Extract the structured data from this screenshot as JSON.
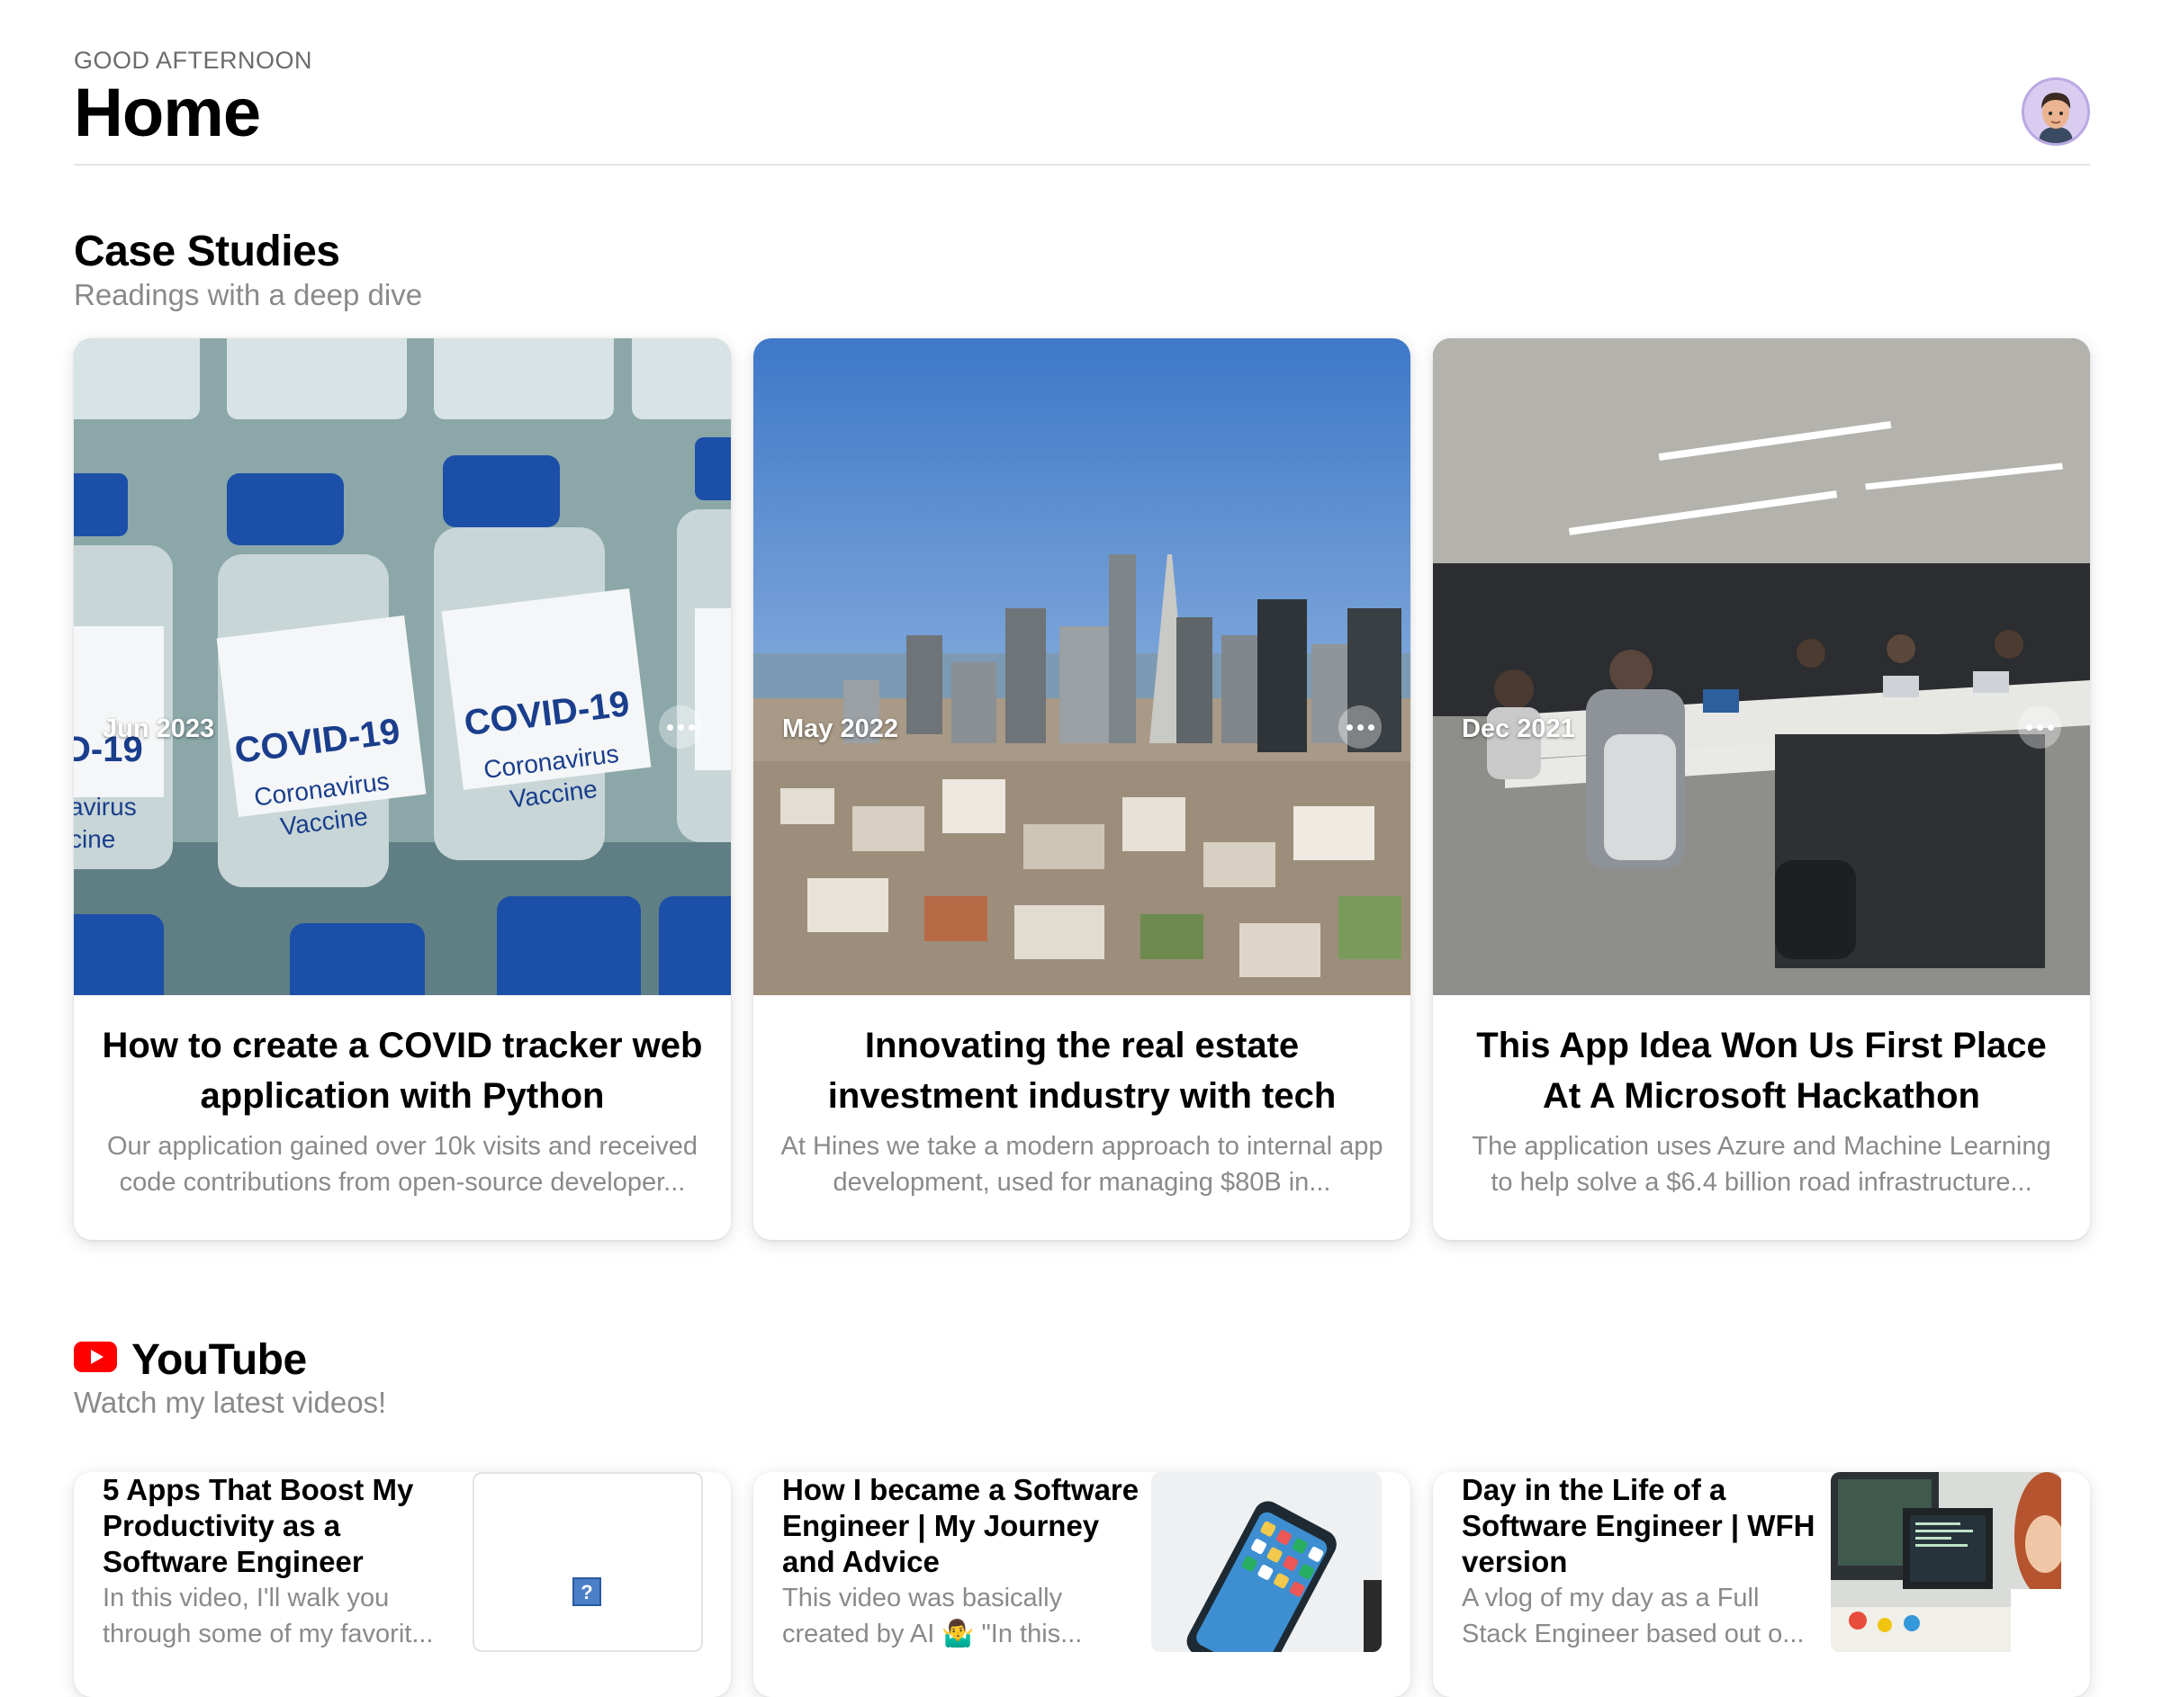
{
  "header": {
    "greeting": "GOOD AFTERNOON",
    "title": "Home",
    "avatar_icon": "memoji-avatar-icon"
  },
  "case_studies": {
    "title": "Case Studies",
    "subtitle": "Readings with a deep dive",
    "cards": [
      {
        "date": "Jun 2023",
        "title": "How to create a COVID tracker web application with Python",
        "description": "Our application gained over 10k visits and received code contributions from open-source developer...",
        "image": "covid-vaccine-vials",
        "image_texts": [
          "COVID-19",
          "Coronavirus",
          "Vaccine"
        ]
      },
      {
        "date": "May 2022",
        "title": "Innovating the real estate investment industry with tech",
        "description": "At Hines we take a modern approach to internal app development, used for managing $80B in...",
        "image": "city-skyline"
      },
      {
        "date": "Dec 2021",
        "title": "This App Idea Won Us First Place At A Microsoft Hackathon",
        "description": "The application uses Azure and Machine Learning to help solve a $6.4 billion road infrastructure...",
        "image": "open-office"
      }
    ]
  },
  "youtube": {
    "title": "YouTube",
    "subtitle": "Watch my latest videos!",
    "videos": [
      {
        "title": "5 Apps That Boost My Productivity as a Software Engineer",
        "description": "In this video, I'll walk you through some of my favorit...",
        "thumbnail": "broken-image-icon"
      },
      {
        "title": "How I became a Software Engineer | My Journey and Advice",
        "description": "This video was basically created by AI 🤷‍♂️ \"In this...",
        "thumbnail": "phone-apps"
      },
      {
        "title": "Day in the Life of a Software Engineer | WFH version",
        "description": "A vlog of my day as a Full Stack Engineer based out o...",
        "thumbnail": "desk-monitors"
      }
    ]
  },
  "colors": {
    "accent_red": "#ff0000",
    "muted_text": "#8a8a8a"
  }
}
